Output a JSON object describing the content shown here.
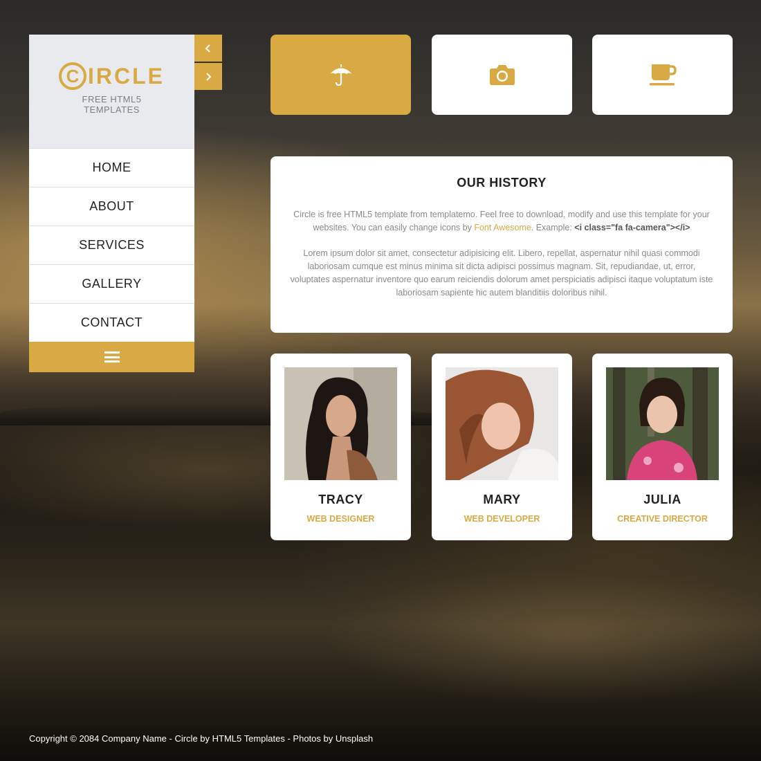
{
  "brand": {
    "logo_c": "C",
    "logo_rest": "IRCLE",
    "tagline_line1": "FREE HTML5",
    "tagline_line2": "TEMPLATES"
  },
  "menu": {
    "items": [
      {
        "label": "HOME"
      },
      {
        "label": "ABOUT"
      },
      {
        "label": "SERVICES"
      },
      {
        "label": "GALLERY"
      },
      {
        "label": "CONTACT"
      }
    ],
    "toggle_icon": "hamburger-icon"
  },
  "nav_arrows": {
    "prev_icon": "chevron-left-icon",
    "next_icon": "chevron-right-icon"
  },
  "tiles": [
    {
      "icon": "umbrella-icon",
      "active": true
    },
    {
      "icon": "camera-icon",
      "active": false
    },
    {
      "icon": "coffee-icon",
      "active": false
    }
  ],
  "history": {
    "title": "OUR HISTORY",
    "p1_text": "Circle is free HTML5 template from templatemo. Feel free to download, modify and use this template for your websites. You can easily change icons by ",
    "p1_link": "Font Awesome",
    "p1_mid": ". Example: ",
    "p1_code": "<i class=\"fa fa-camera\"></i>",
    "p2_text": "Lorem ipsum dolor sit amet, consectetur adipisicing elit. Libero, repellat, aspernatur nihil quasi commodi laboriosam cumque est minus minima sit dicta adipisci possimus magnam. Sit, repudiandae, ut, error, voluptates aspernatur inventore quo earum reiciendis dolorum amet perspiciatis adipisci itaque voluptatum iste laboriosam sapiente hic autem blanditiis doloribus nihil."
  },
  "team": [
    {
      "name": "TRACY",
      "role": "WEB DESIGNER"
    },
    {
      "name": "MARY",
      "role": "WEB DEVELOPER"
    },
    {
      "name": "JULIA",
      "role": "CREATIVE DIRECTOR"
    }
  ],
  "colors": {
    "accent": "#d9aa43",
    "panel": "#ffffff",
    "brand_bg": "#e8eaee"
  },
  "footer": {
    "text": "Copyright © 2084 Company Name - Circle by HTML5 Templates - Photos by Unsplash"
  }
}
